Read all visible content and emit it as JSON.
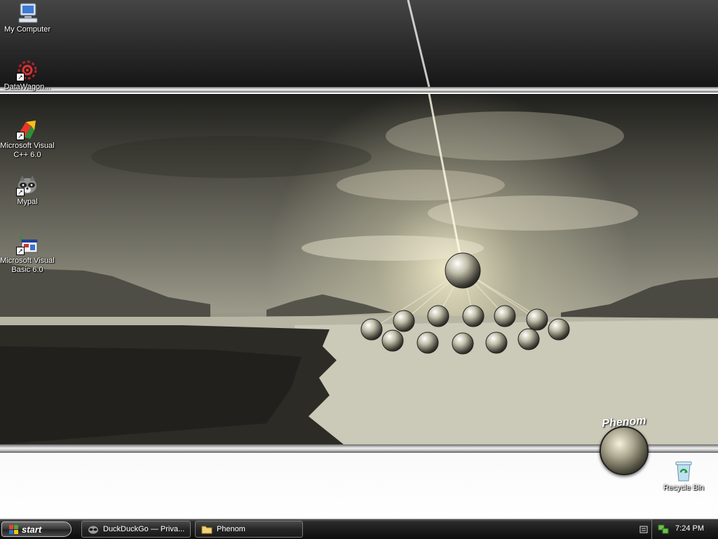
{
  "desktop": {
    "icons": [
      {
        "label": "My Computer"
      },
      {
        "label": "DataWagon..."
      },
      {
        "label": "Microsoft Visual C++ 6.0"
      },
      {
        "label": "Mypal"
      },
      {
        "label": "Microsoft Visual Basic 6.0"
      },
      {
        "label": "Recycle Bin"
      }
    ],
    "logo_text": "Phenom"
  },
  "taskbar": {
    "start_label": "start",
    "windows": [
      {
        "label": "DuckDuckGo — Priva..."
      },
      {
        "label": "Phenom"
      }
    ],
    "clock": "7:24 PM"
  }
}
